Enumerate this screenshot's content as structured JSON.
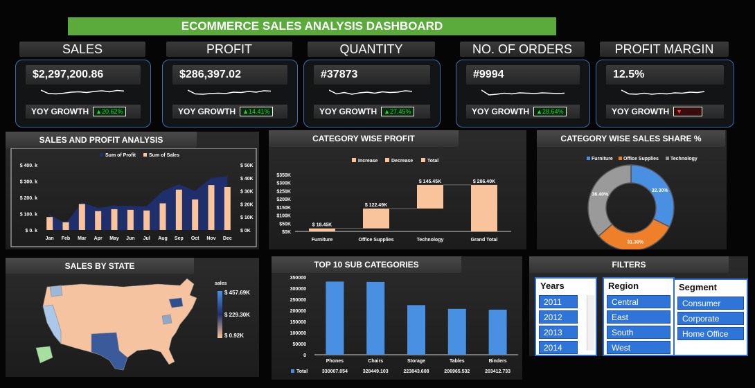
{
  "title": "ECOMMERCE SALES ANALYSIS DASHBOARD",
  "kpis": [
    {
      "label": "SALES",
      "value": "$2,297,200.86",
      "yoy_label": "YOY GROWTH",
      "yoy": "20.62%",
      "dir": "up",
      "arrow": "▲"
    },
    {
      "label": "PROFIT",
      "value": "$286,397.02",
      "yoy_label": "YOY GROWTH",
      "yoy": "14.41%",
      "dir": "up",
      "arrow": "▲"
    },
    {
      "label": "QUANTITY",
      "value": "#37873",
      "yoy_label": "YOY GROWTH",
      "yoy": "27.45%",
      "dir": "up",
      "arrow": "▲"
    },
    {
      "label": "NO. OF ORDERS",
      "value": "#9994",
      "yoy_label": "YOY GROWTH",
      "yoy": "28.64%",
      "dir": "up",
      "arrow": "▲"
    },
    {
      "label": "PROFIT MARGIN",
      "value": "12.5%",
      "yoy_label": "YOY GROWTH",
      "yoy": "",
      "dir": "down",
      "arrow": "▼"
    }
  ],
  "panels": {
    "sales_profit": "SALES AND PROFIT ANALYSIS",
    "category_profit": "CATEGORY WISE PROFIT",
    "category_share": "CATEGORY WISE SALES SHARE %",
    "sales_state": "SALES BY STATE",
    "top10": "TOP 10 SUB CATEGORIES",
    "filters": "FILTERS"
  },
  "colors": {
    "profit": "#1f2f6b",
    "sales": "#f9c49b",
    "increase": "#f9c49b",
    "furniture": "#4a90e2",
    "office": "#f07f2a",
    "technology": "#9a9a9a",
    "bar_blue": "#4a90e2",
    "accent_green": "#5aaa3c"
  },
  "chart_data": [
    {
      "type": "bar",
      "title": "SALES AND PROFIT ANALYSIS",
      "categories": [
        "Jan",
        "Feb",
        "Mar",
        "Apr",
        "May",
        "Jun",
        "Jul",
        "Aug",
        "Sep",
        "Oct",
        "Nov",
        "Dec"
      ],
      "series": [
        {
          "name": "Sum of Profit",
          "type": "area",
          "axis": "left",
          "values": [
            95000,
            40000,
            170000,
            135000,
            150000,
            148000,
            145000,
            240000,
            280000,
            240000,
            320000,
            330000
          ]
        },
        {
          "name": "Sum of Sales",
          "type": "bar",
          "axis": "right",
          "values": [
            10000,
            6000,
            20000,
            14500,
            16000,
            15500,
            15000,
            20500,
            31000,
            23500,
            34500,
            33000
          ]
        }
      ],
      "y_left_ticks": [
        "$ 0. k",
        "$ 100. k",
        "$ 200. k",
        "$ 300. k",
        "$ 400. k"
      ],
      "y_right_ticks": [
        "$ 0K",
        "$ 10K",
        "$ 20K",
        "$ 30K",
        "$ 40K",
        "$ 50K"
      ],
      "ylim_left": [
        0,
        400000
      ],
      "ylim_right": [
        0,
        50000
      ]
    },
    {
      "type": "bar",
      "subtype": "waterfall",
      "title": "CATEGORY WISE PROFIT",
      "legend": [
        "Increase",
        "Decrease",
        "Total"
      ],
      "categories": [
        "Furniture",
        "Office Supplies",
        "Technology",
        "Grand Total"
      ],
      "values": [
        18450,
        122490,
        145450,
        286400
      ],
      "labels": [
        "$ 18.45K",
        "$ 122.49K",
        "$ 145.45K",
        "$ 286.40K"
      ],
      "y_ticks": [
        "$0K",
        "$50K",
        "$100K",
        "$150K",
        "$200K",
        "$250K",
        "$300K",
        "$350K"
      ],
      "ylim": [
        0,
        350000
      ]
    },
    {
      "type": "pie",
      "subtype": "donut",
      "title": "CATEGORY WISE SALES SHARE %",
      "categories": [
        "Furniture",
        "Office Supplies",
        "Technology"
      ],
      "values": [
        32.3,
        31.3,
        36.4
      ],
      "labels": [
        "32.30%",
        "31.30%",
        "36.40%"
      ]
    },
    {
      "type": "bar",
      "title": "TOP 10 SUB CATEGORIES",
      "categories": [
        "Phones",
        "Chairs",
        "Storage",
        "Tables",
        "Binders"
      ],
      "series": [
        {
          "name": "Total",
          "values": [
            330007.054,
            328449.103,
            223843.608,
            206965.532,
            203412.733
          ]
        }
      ],
      "value_labels": [
        "330007.054",
        "328449.103",
        "223843.608",
        "206965.532",
        "203412.733"
      ],
      "y_ticks": [
        "0",
        "50000",
        "100000",
        "150000",
        "200000",
        "250000",
        "300000",
        "350000"
      ],
      "ylim": [
        0,
        350000
      ]
    }
  ],
  "map": {
    "legend_title": "sales",
    "legend_labels": [
      "$ 457.69K",
      "$ 229.30K",
      "$ 0.92K"
    ]
  },
  "filters": {
    "years": {
      "label": "Years",
      "items": [
        "2011",
        "2012",
        "2013",
        "2014"
      ]
    },
    "region": {
      "label": "Region",
      "items": [
        "Central",
        "East",
        "South",
        "West"
      ]
    },
    "segment": {
      "label": "Segment",
      "items": [
        "Consumer",
        "Corporate",
        "Home Office"
      ]
    }
  }
}
